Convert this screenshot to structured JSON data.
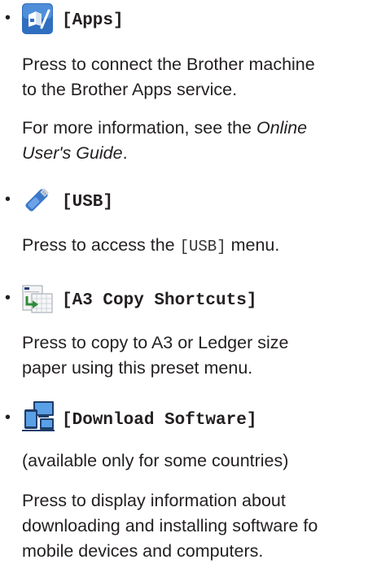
{
  "items": [
    {
      "label": "[Apps]",
      "icon": "apps-icon",
      "desc_lines": [
        "Press to connect the Brother machine",
        "to the Brother Apps service."
      ],
      "more_prefix": "For more information, see the ",
      "more_link": "Online",
      "more_link2": "User's Guide",
      "more_suffix": "."
    },
    {
      "label": "[USB]",
      "icon": "usb-icon",
      "desc_before": "Press to access the ",
      "desc_code": "[USB]",
      "desc_after": " menu."
    },
    {
      "label": "[A3 Copy Shortcuts]",
      "icon": "a3-copy-shortcuts-icon",
      "desc_lines": [
        "Press to copy to A3 or Ledger size",
        "paper using this preset menu."
      ]
    },
    {
      "label": "[Download Software]",
      "icon": "download-software-icon",
      "note": "(available only for some countries)",
      "desc_lines": [
        "Press to display information about",
        "downloading and installing software fo",
        "mobile devices and computers."
      ]
    }
  ],
  "colors": {
    "text": "#231f20",
    "apps_blue": "#2f6fbf",
    "usb_blue": "#3a78c9",
    "green": "#2e8b3a"
  }
}
